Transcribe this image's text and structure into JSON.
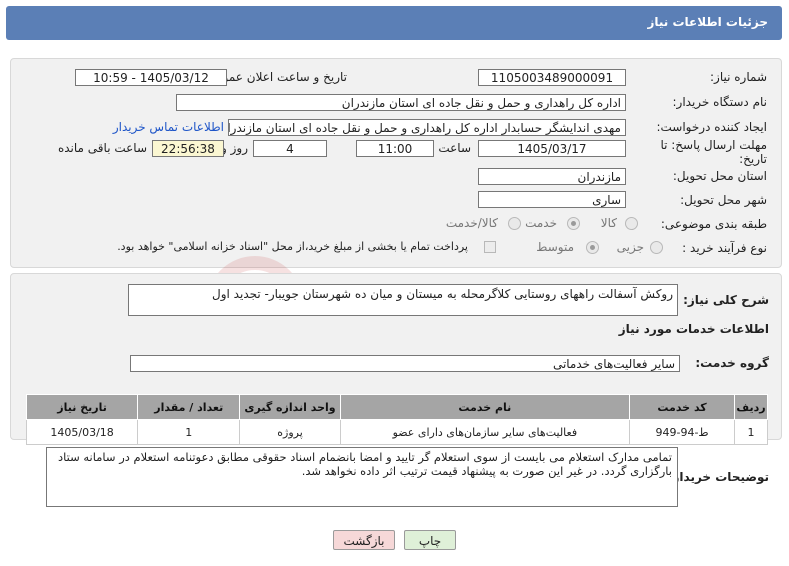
{
  "header": {
    "title": "جزئیات اطلاعات نیاز"
  },
  "form": {
    "need_number": {
      "label": "شماره نیاز:",
      "value": "1105003489000091"
    },
    "announce": {
      "label": "تاریخ و ساعت اعلان عمومی:",
      "value": "1405/03/12 - 10:59"
    },
    "buyer_org": {
      "label": "نام دستگاه خریدار:",
      "value": "اداره کل راهداری و حمل و نقل جاده ای استان مازندران"
    },
    "creator": {
      "label": "ایجاد کننده درخواست:",
      "value": "مهدی اندایشگر حسابدار اداره کل راهداری و حمل و نقل جاده ای استان مازندران",
      "contact_link": "اطلاعات تماس خریدار"
    },
    "deadline": {
      "label_line1": "مهلت ارسال پاسخ: تا",
      "label_line2": "تاریخ:",
      "date": "1405/03/17",
      "time_label": "ساعت",
      "time": "11:00",
      "days": "4",
      "days_label": "روز و",
      "remaining": "22:56:38",
      "remaining_label": "ساعت باقی مانده"
    },
    "province": {
      "label": "استان محل تحویل:",
      "value": "مازندران"
    },
    "city": {
      "label": "شهر محل تحویل:",
      "value": "ساری"
    },
    "category": {
      "label": "طبقه بندی موضوعی:",
      "options": [
        "کالا",
        "خدمت",
        "کالا/خدمت"
      ],
      "selected": "خدمت"
    },
    "purchase_type": {
      "label": "نوع فرآیند خرید :",
      "options": [
        "جزیی",
        "متوسط"
      ],
      "selected": "متوسط",
      "note": "پرداخت تمام یا بخشی از مبلغ خرید،از محل \"اسناد خزانه اسلامی\" خواهد بود."
    }
  },
  "summary": {
    "label": "شرح کلی نیاز:",
    "value": "روکش آسفالت راههای روستایی کلاگرمحله به میستان و میان ده شهرستان جویبار- تجدید اول"
  },
  "services": {
    "section_title": "اطلاعات خدمات مورد نیاز",
    "group_label": "گروه خدمت:",
    "group_value": "سایر فعالیت‌های خدماتی",
    "columns": [
      "ردیف",
      "کد خدمت",
      "نام خدمت",
      "واحد اندازه گیری",
      "تعداد / مقدار",
      "تاریخ نیاز"
    ],
    "rows": [
      [
        "1",
        "ط-94-949",
        "فعالیت‌های سایر سازمان‌های دارای عضو",
        "پروژه",
        "1",
        "1405/03/18"
      ]
    ]
  },
  "notes": {
    "label": "توضیحات خریدار:",
    "value": "تمامی مدارک استعلام می بایست از سوی استعلام گر تایید و امضا بانضمام اسناد حقوقی مطابق دعوتنامه استعلام در سامانه ستاد بارگزاری گردد. در غیر این صورت به پیشنهاد قیمت ترتیب اثر داده نخواهد شد."
  },
  "buttons": {
    "print": "چاپ",
    "back": "بازگشت"
  },
  "watermark": {
    "text": "AriaTender.net"
  },
  "colors": {
    "header": "#5b7fb6",
    "table_header": "#a5a5a5",
    "highlight": "#fbf7d2",
    "link": "#1e55c8",
    "back_button": "#f6d8d8",
    "print_button": "#dff0d8"
  }
}
